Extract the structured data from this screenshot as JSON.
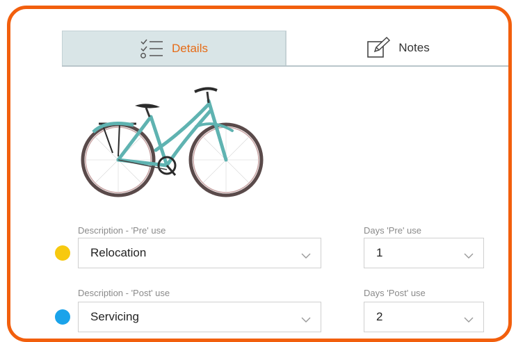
{
  "tabs": [
    {
      "label": "Details",
      "icon": "checklist-icon",
      "active": true
    },
    {
      "label": "Notes",
      "icon": "edit-note-icon",
      "active": false
    }
  ],
  "colors": {
    "frame": "#f25f0d",
    "accent": "#e66b16",
    "pre_dot": "#f7c90f",
    "post_dot": "#1aa3ea",
    "bike": "#5fb3b1"
  },
  "form": {
    "pre_description": {
      "label": "Description - 'Pre' use",
      "value": "Relocation"
    },
    "pre_days": {
      "label": "Days 'Pre' use",
      "value": "1"
    },
    "post_description": {
      "label": "Description - 'Post' use",
      "value": "Servicing"
    },
    "post_days": {
      "label": "Days 'Post' use",
      "value": "2"
    }
  }
}
